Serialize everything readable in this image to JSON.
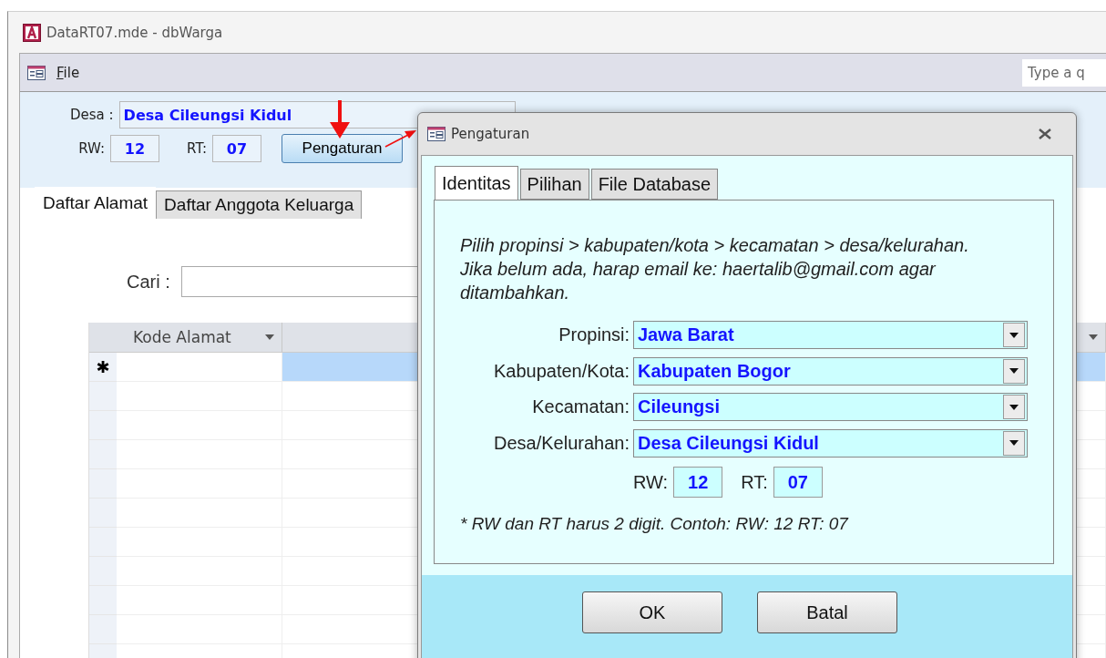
{
  "app_window": {
    "title": "DataRT07.mde - dbWarga"
  },
  "menu": {
    "items": [
      {
        "label": "File"
      }
    ]
  },
  "help_search": {
    "placeholder": "Type a q"
  },
  "header": {
    "desa_label": "Desa :",
    "desa_value": "Desa Cileungsi Kidul",
    "rw_label": "RW:",
    "rw_value": "12",
    "rt_label": "RT:",
    "rt_value": "07",
    "settings_button": "Pengaturan"
  },
  "tabs": [
    {
      "label": "Daftar Alamat",
      "selected": true
    },
    {
      "label": "Daftar Anggota Keluarga",
      "selected": false
    }
  ],
  "search": {
    "label": "Cari :"
  },
  "table": {
    "columns": [
      "Kode Alamat"
    ],
    "new_row_marker": "✱"
  },
  "dialog": {
    "title": "Pengaturan",
    "tabs": [
      {
        "label": "Identitas",
        "selected": true
      },
      {
        "label": "Pilihan",
        "selected": false
      },
      {
        "label": "File Database",
        "selected": false
      }
    ],
    "instructions": [
      "Pilih propinsi > kabupaten/kota > kecamatan > desa/kelurahan.",
      "Jika belum ada, harap email ke: haertalib@gmail.com agar ditambahkan."
    ],
    "fields": [
      {
        "label": "Propinsi:",
        "value": "Jawa Barat"
      },
      {
        "label": "Kabupaten/Kota:",
        "value": "Kabupaten Bogor"
      },
      {
        "label": "Kecamatan:",
        "value": "Cileungsi"
      },
      {
        "label": "Desa/Kelurahan:",
        "value": "Desa Cileungsi Kidul"
      }
    ],
    "rw_label": "RW:",
    "rw_value": "12",
    "rt_label": "RT:",
    "rt_value": "07",
    "note": "* RW dan RT harus 2 digit. Contoh: RW: 12 RT: 07",
    "buttons": [
      "OK",
      "Batal"
    ]
  }
}
